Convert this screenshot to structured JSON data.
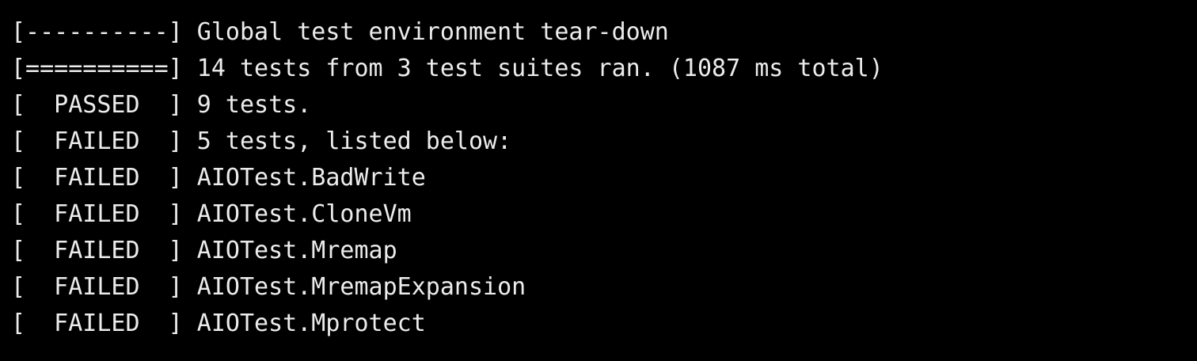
{
  "colors": {
    "background": "#000000",
    "text": "#ececec"
  },
  "lines": [
    {
      "tag": "[----------]",
      "text": " Global test environment tear-down"
    },
    {
      "tag": "[==========]",
      "text": " 14 tests from 3 test suites ran. (1087 ms total)"
    },
    {
      "tag": "[  PASSED  ]",
      "text": " 9 tests."
    },
    {
      "tag": "[  FAILED  ]",
      "text": " 5 tests, listed below:"
    },
    {
      "tag": "[  FAILED  ]",
      "text": " AIOTest.BadWrite"
    },
    {
      "tag": "[  FAILED  ]",
      "text": " AIOTest.CloneVm"
    },
    {
      "tag": "[  FAILED  ]",
      "text": " AIOTest.Mremap"
    },
    {
      "tag": "[  FAILED  ]",
      "text": " AIOTest.MremapExpansion"
    },
    {
      "tag": "[  FAILED  ]",
      "text": " AIOTest.Mprotect"
    }
  ]
}
